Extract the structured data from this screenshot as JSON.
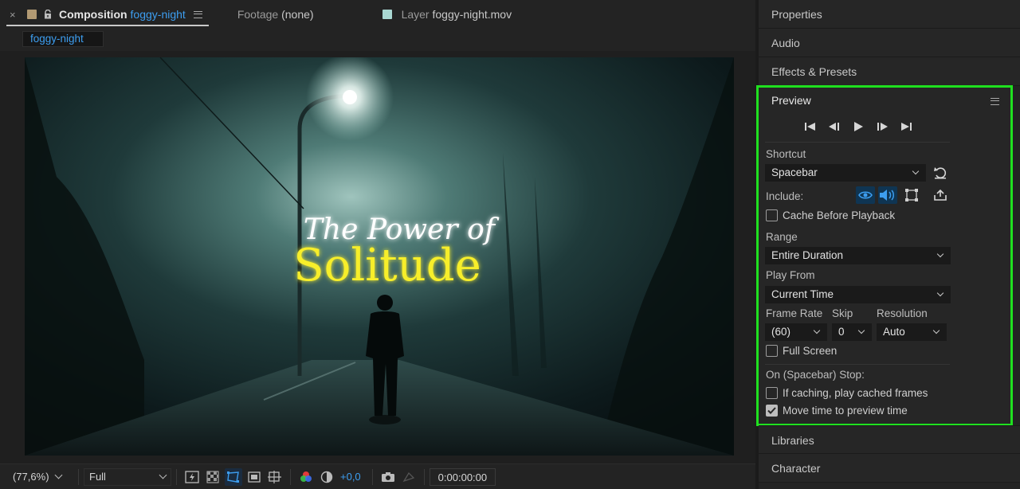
{
  "composition_tab": {
    "close": "×",
    "label": "Composition",
    "name": "foggy-night",
    "swatch_color": "#b29a73"
  },
  "footage_tab": {
    "label": "Footage",
    "value": "(none)"
  },
  "layer_tab": {
    "label": "Layer",
    "value": "foggy-night.mov",
    "swatch_color": "#a9d7d2"
  },
  "subtab": {
    "label": "foggy-night"
  },
  "frame": {
    "title_line1": "The Power of",
    "title_line2": "Solitude"
  },
  "bottom_bar": {
    "zoom": "(77,6%)",
    "resolution": "Full",
    "exposure": "+0,0",
    "timecode": "0:00:00:00"
  },
  "side_panels": {
    "properties": "Properties",
    "audio": "Audio",
    "effects": "Effects & Presets",
    "libraries": "Libraries",
    "character": "Character"
  },
  "preview": {
    "title": "Preview",
    "shortcut_label": "Shortcut",
    "shortcut_value": "Spacebar",
    "include_label": "Include:",
    "cache_before": "Cache Before Playback",
    "range_label": "Range",
    "range_value": "Entire Duration",
    "play_from_label": "Play From",
    "play_from_value": "Current Time",
    "frame_rate_label": "Frame Rate",
    "skip_label": "Skip",
    "resolution_label": "Resolution",
    "frame_rate_value": "(60)",
    "skip_value": "0",
    "resolution_value": "Auto",
    "full_screen": "Full Screen",
    "on_stop_label": "On (Spacebar) Stop:",
    "if_caching": "If caching, play cached frames",
    "move_time": "Move time to preview time",
    "highlight_color": "#1fe01f"
  }
}
